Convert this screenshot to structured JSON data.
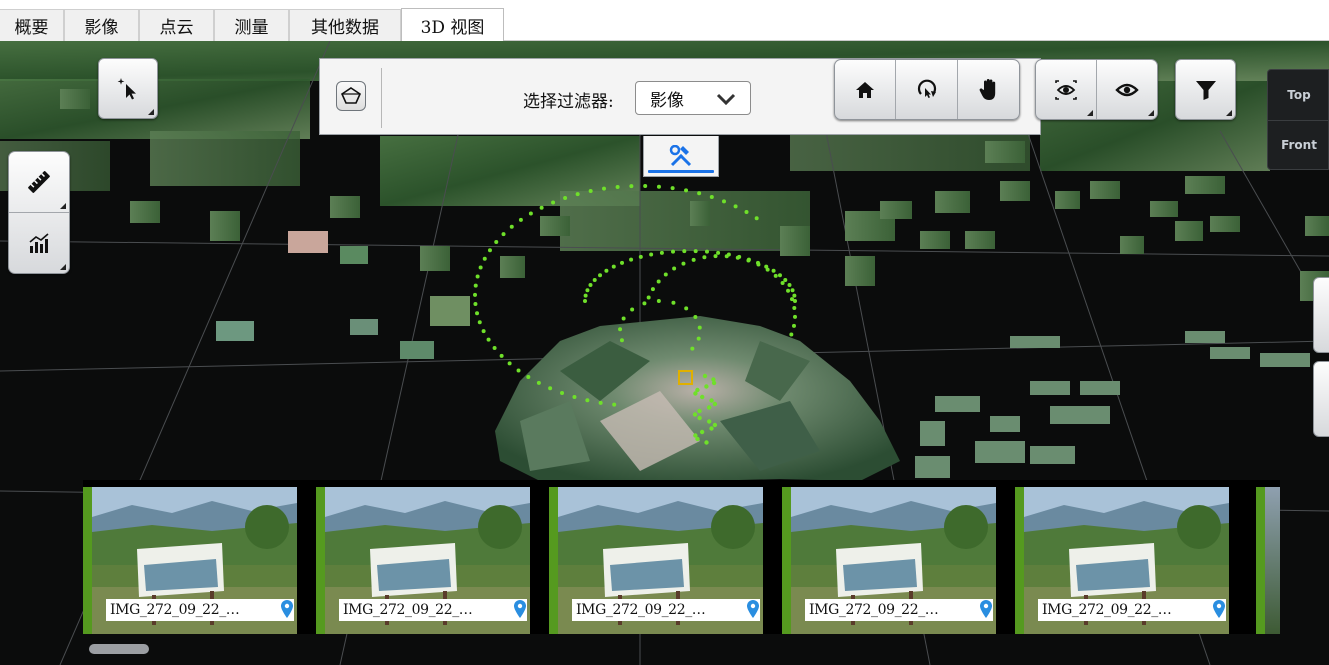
{
  "tabs": [
    {
      "label": "概要"
    },
    {
      "label": "影像"
    },
    {
      "label": "点云"
    },
    {
      "label": "测量"
    },
    {
      "label": "其他数据"
    },
    {
      "label": "3D 视图",
      "active": true
    }
  ],
  "filter": {
    "label": "选择过滤器:",
    "selected": "影像",
    "icon": "polygon-filter-icon"
  },
  "tools_tab_icon": "tools-icon",
  "left_tools": [
    {
      "name": "select-tool",
      "icon": "cursor-sparkle-icon"
    },
    {
      "name": "measure-tool",
      "icon": "ruler-icon"
    },
    {
      "name": "chart-tool",
      "icon": "chart-icon"
    }
  ],
  "navigation_tools": [
    {
      "name": "home",
      "icon": "home-icon"
    },
    {
      "name": "orbit",
      "icon": "orbit-icon"
    },
    {
      "name": "pan",
      "icon": "hand-icon"
    }
  ],
  "visibility_tools": [
    {
      "name": "focus-view",
      "icon": "eye-focus-icon"
    },
    {
      "name": "visibility",
      "icon": "eye-icon"
    }
  ],
  "filter_button_icon": "funnel-icon",
  "viewcube": {
    "top": "Top",
    "front": "Front"
  },
  "images": [
    {
      "caption": "IMG_272_09_22_…"
    },
    {
      "caption": "IMG_272_09_22_…"
    },
    {
      "caption": "IMG_272_09_22_…"
    },
    {
      "caption": "IMG_272_09_22_…"
    },
    {
      "caption": "IMG_272_09_22_…"
    }
  ],
  "colors": {
    "viewport_bg": "#0b0c0c",
    "vegetation": "#3f6f3a",
    "camera_points": "#6fe02a",
    "thumb_accent": "#559a1f",
    "pin": "#2a8ee0",
    "active_indicator": "#1b73e8"
  }
}
